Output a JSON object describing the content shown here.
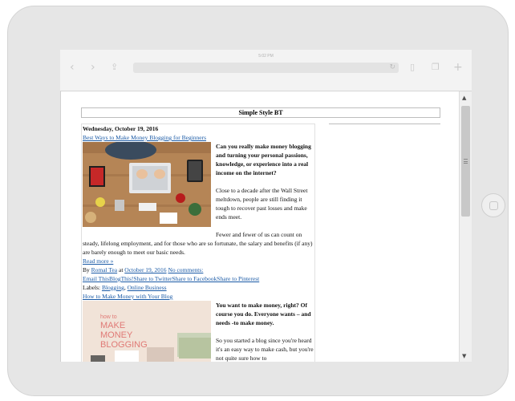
{
  "status_bar": {
    "time": "5:02 PM"
  },
  "browser": {
    "icons": {
      "back": "chevron-left-icon",
      "forward": "chevron-right-icon",
      "share": "share-icon",
      "reload": "reload-icon",
      "reader": "book-icon",
      "tabs": "tabs-icon",
      "add": "plus-icon"
    }
  },
  "blog": {
    "title": "Simple Style BT",
    "date": "Wednesday, October 19, 2016",
    "post1": {
      "title": "Best Ways to Make Money Blogging for Beginners",
      "lead": "Can you really make money blogging and turning your personal passions, knowledge, or experience into a real income on the internet?",
      "p1": "Close to a decade after the Wall Street meltdown, people are still finding it tough to recover past losses and make ends meet.",
      "p2_start": "Fewer and fewer of us can count on",
      "p2_rest": "steady, lifelong employment, and for those who are so fortunate, the salary and benefits (if any) are barely enough to meet our basic needs.",
      "read_more": "Read more »",
      "by": "By",
      "author": "Romal Tea",
      "at": "at",
      "time": "October 19, 2016",
      "comments": "No comments:",
      "share_links": "Email ThisBlogThis!Share to TwitterShare to FacebookShare to Pinterest",
      "labels_prefix": "Labels:",
      "label1": "Blogging",
      "label_sep": ",",
      "label2": "Online Business"
    },
    "post2": {
      "title": "How to Make Money with Your Blog",
      "lead": "You want to make money, right? Of course you do. Everyone wants – and needs -to make money.",
      "p1": "So you started a blog since you're heard it's an easy way to make cash, but you're not quite sure how to",
      "image_text_1": "how to",
      "image_text_2": "MAKE",
      "image_text_3": "MONEY",
      "image_text_4": "BLOGGING"
    }
  },
  "colors": {
    "link": "#1a5aa6",
    "frame": "#e6e6e6",
    "toolbar": "#f3f3f3"
  }
}
